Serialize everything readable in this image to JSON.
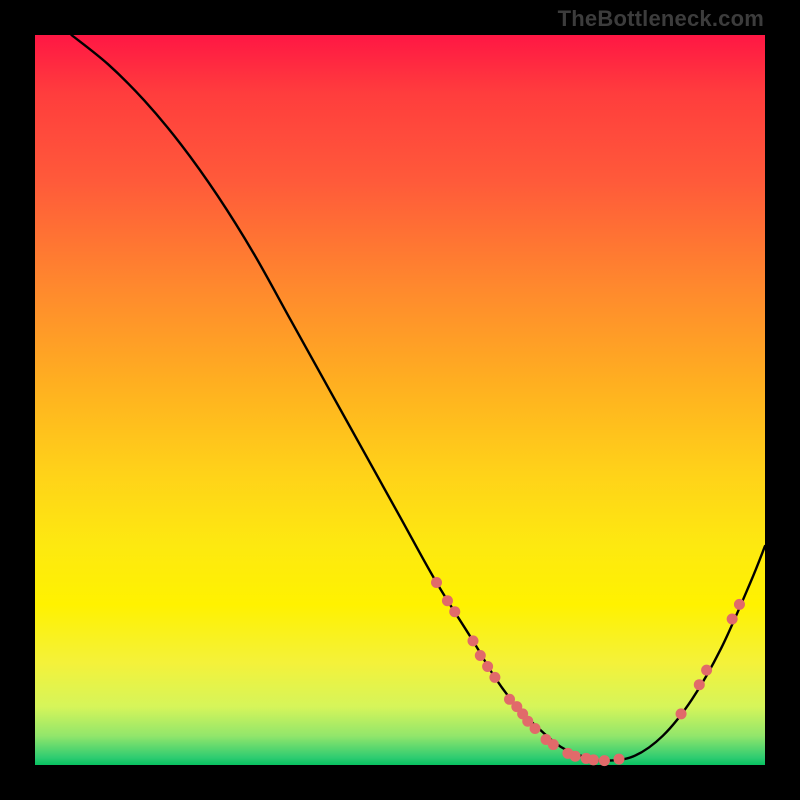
{
  "watermark": "TheBottleneck.com",
  "chart_data": {
    "type": "line",
    "title": "",
    "xlabel": "",
    "ylabel": "",
    "xlim": [
      0,
      100
    ],
    "ylim": [
      0,
      100
    ],
    "legend": false,
    "grid": false,
    "series": [
      {
        "name": "curve",
        "x": [
          5,
          10,
          15,
          20,
          25,
          30,
          35,
          40,
          45,
          50,
          55,
          60,
          63,
          66,
          69,
          72,
          75,
          78,
          82,
          86,
          90,
          94,
          98,
          100
        ],
        "y": [
          100,
          96,
          91,
          85,
          78,
          70,
          61,
          52,
          43,
          34,
          25,
          17,
          12,
          8,
          5,
          2.5,
          1.2,
          0.6,
          1.2,
          4,
          9,
          16,
          25,
          30
        ]
      }
    ],
    "markers": [
      {
        "x": 55.0,
        "y": 25.0
      },
      {
        "x": 56.5,
        "y": 22.5
      },
      {
        "x": 57.5,
        "y": 21.0
      },
      {
        "x": 60.0,
        "y": 17.0
      },
      {
        "x": 61.0,
        "y": 15.0
      },
      {
        "x": 62.0,
        "y": 13.5
      },
      {
        "x": 63.0,
        "y": 12.0
      },
      {
        "x": 65.0,
        "y": 9.0
      },
      {
        "x": 66.0,
        "y": 8.0
      },
      {
        "x": 66.8,
        "y": 7.0
      },
      {
        "x": 67.5,
        "y": 6.0
      },
      {
        "x": 68.5,
        "y": 5.0
      },
      {
        "x": 70.0,
        "y": 3.5
      },
      {
        "x": 71.0,
        "y": 2.8
      },
      {
        "x": 73.0,
        "y": 1.6
      },
      {
        "x": 74.0,
        "y": 1.2
      },
      {
        "x": 75.5,
        "y": 0.9
      },
      {
        "x": 76.5,
        "y": 0.7
      },
      {
        "x": 78.0,
        "y": 0.6
      },
      {
        "x": 80.0,
        "y": 0.8
      },
      {
        "x": 88.5,
        "y": 7.0
      },
      {
        "x": 91.0,
        "y": 11.0
      },
      {
        "x": 92.0,
        "y": 13.0
      },
      {
        "x": 95.5,
        "y": 20.0
      },
      {
        "x": 96.5,
        "y": 22.0
      }
    ],
    "marker_color": "#e16a6a",
    "line_color": "#000000"
  }
}
